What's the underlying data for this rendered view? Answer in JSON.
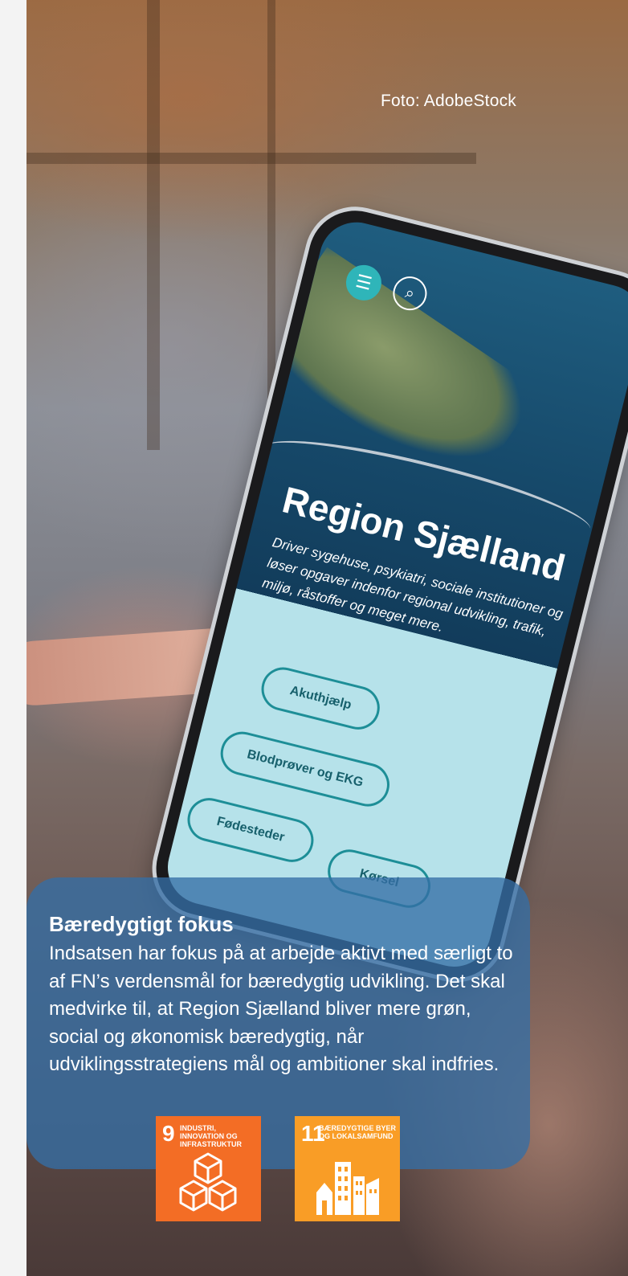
{
  "photo": {
    "credit": "Foto: AdobeStock"
  },
  "phone_screen": {
    "menu_icon": "hamburger-icon",
    "search_icon": "search-icon",
    "title": "Region Sjælland",
    "description": "Driver sygehuse, psykiatri, sociale institutioner og løser opgaver indenfor regional udvikling, trafik, miljø, råstoffer og meget mere.",
    "buttons": [
      "Akuthjælp",
      "Blodprøver og EKG",
      "Fødesteder",
      "Kørsel"
    ]
  },
  "info_box": {
    "title": "Bæredygtigt fokus",
    "body": "Indsatsen har fokus på at arbejde aktivt med særligt to af FN’s verdensmål for bæredygtig udvikling. Det skal medvirke til, at Region Sjælland bliver mere grøn, social og økonomisk bæredygtig, når udviklingsstrategiens mål og ambitioner skal indfries."
  },
  "sdg_icons": [
    {
      "number": "9",
      "label": "Industri, innovation og infrastruktur",
      "color": "#f36d25"
    },
    {
      "number": "11",
      "label": "Bæredygtige byer og lokalsamfund",
      "color": "#f99d26"
    }
  ]
}
